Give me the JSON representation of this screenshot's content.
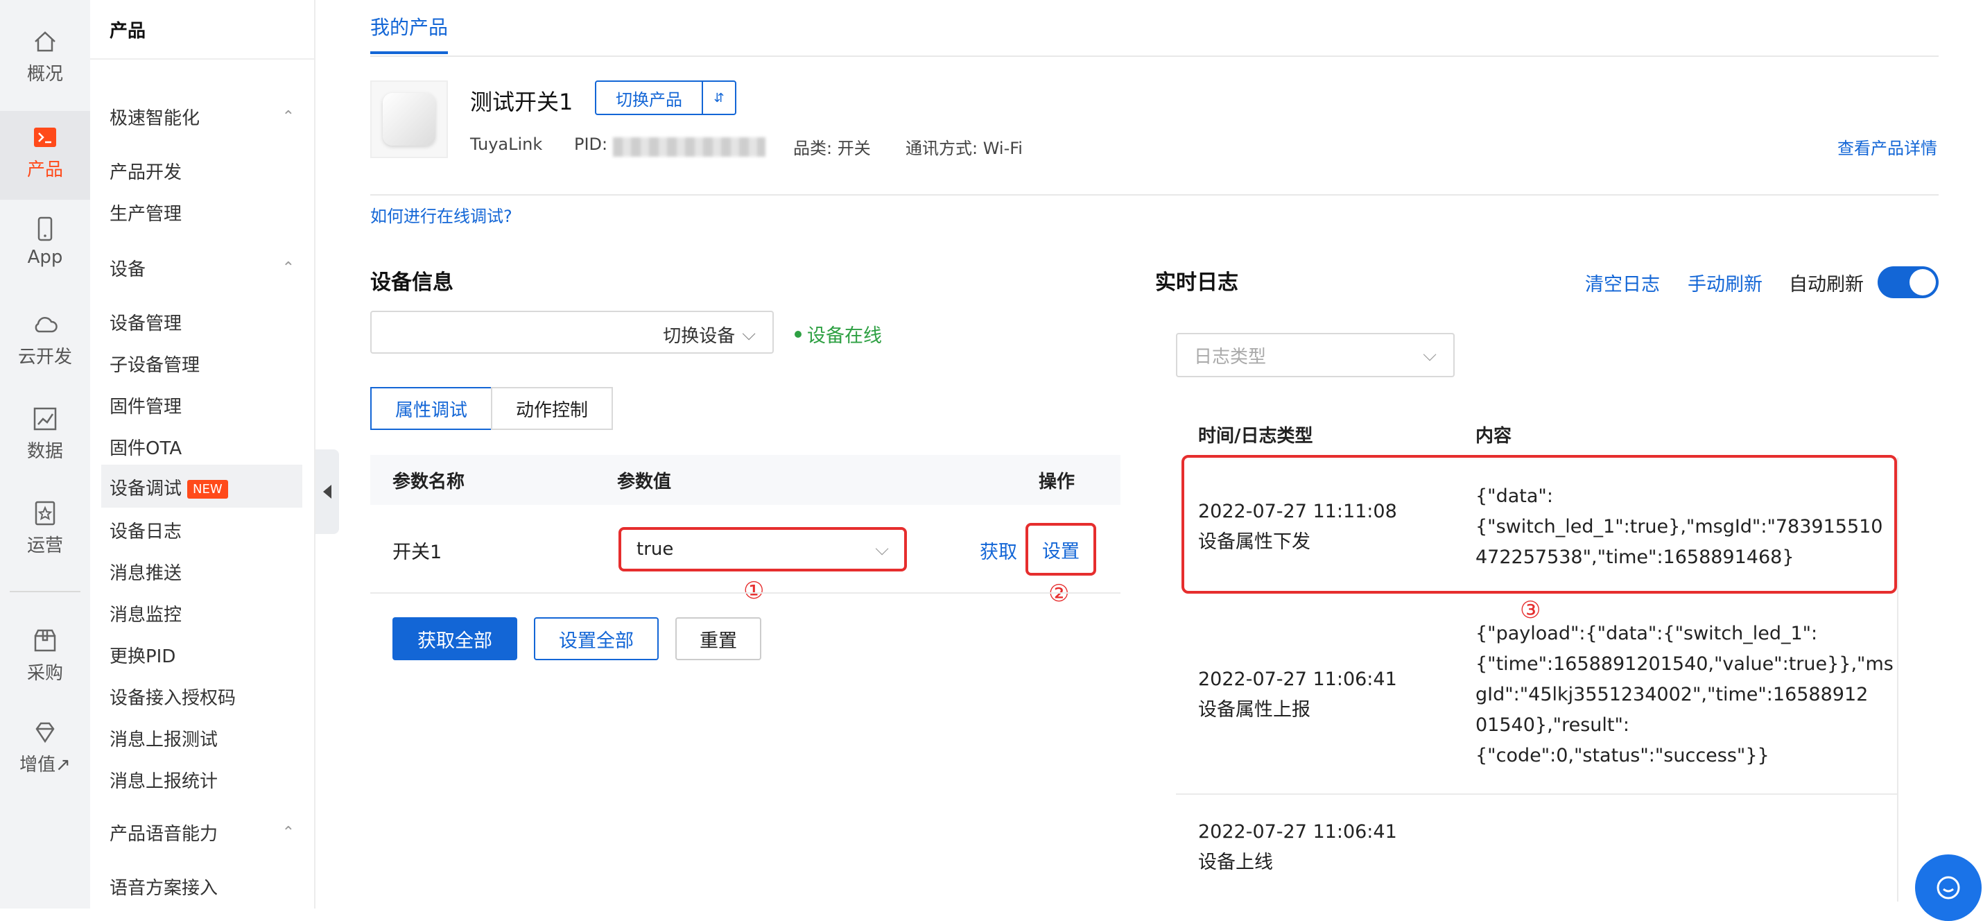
{
  "rail": {
    "items": [
      {
        "label": "概况",
        "icon": "home-icon"
      },
      {
        "label": "产品",
        "icon": "terminal-icon"
      },
      {
        "label": "App",
        "icon": "phone-icon"
      },
      {
        "label": "云开发",
        "icon": "cloud-icon"
      },
      {
        "label": "数据",
        "icon": "chart-icon"
      },
      {
        "label": "运营",
        "icon": "star-card-icon"
      },
      {
        "label": "采购",
        "icon": "box-icon"
      },
      {
        "label": "增值↗",
        "icon": "diamond-icon"
      }
    ],
    "accent": "#ff4a1a"
  },
  "menu": {
    "title": "产品",
    "sections": [
      {
        "label": "极速智能化",
        "items": [
          "产品开发",
          "生产管理"
        ]
      },
      {
        "label": "设备",
        "items": [
          "设备管理",
          "子设备管理",
          "固件管理",
          "固件OTA",
          "设备调试",
          "设备日志",
          "消息推送",
          "消息监控",
          "更换PID",
          "设备接入授权码",
          "消息上报测试",
          "消息上报统计"
        ]
      },
      {
        "label": "产品语音能力",
        "items": [
          "语音方案接入"
        ]
      }
    ],
    "active": "设备调试",
    "badge": "NEW"
  },
  "main": {
    "tab": "我的产品",
    "product": {
      "name": "测试开关1",
      "switch_label": "切换产品",
      "protocol": "TuyaLink",
      "pid_label": "PID:",
      "category": "品类: 开关",
      "comm": "通讯方式: Wi-Fi",
      "detail_link": "查看产品详情"
    },
    "help_link": "如何进行在线调试?"
  },
  "device": {
    "title": "设备信息",
    "switch_device": "切换设备",
    "status": "设备在线",
    "tabs": [
      "属性调试",
      "动作控制"
    ],
    "table": {
      "headers": [
        "参数名称",
        "参数值",
        "操作"
      ],
      "row": {
        "name": "开关1",
        "value": "true",
        "get": "获取",
        "set": "设置"
      }
    },
    "markers": [
      "①",
      "②"
    ],
    "buttons": {
      "get_all": "获取全部",
      "set_all": "设置全部",
      "reset": "重置"
    }
  },
  "log": {
    "title": "实时日志",
    "actions": [
      "清空日志",
      "手动刷新"
    ],
    "auto_refresh": "自动刷新",
    "auto_refresh_on": true,
    "type_placeholder": "日志类型",
    "headers": [
      "时间/日志类型",
      "内容"
    ],
    "marker": "③",
    "rows": [
      {
        "time": "2022-07-27 11:11:08",
        "type": "设备属性下发",
        "content": [
          "{\"data\":",
          "{\"switch_led_1\":true},\"msgId\":\"783915510",
          "472257538\",\"time\":1658891468}"
        ]
      },
      {
        "time": "2022-07-27 11:06:41",
        "type": "设备属性上报",
        "content": [
          "{\"payload\":{\"data\":{\"switch_led_1\":",
          "{\"time\":1658891201540,\"value\":true}},\"ms",
          "gId\":\"45lkj3551234002\",\"time\":16588912",
          "01540},\"result\":",
          "{\"code\":0,\"status\":\"success\"}}"
        ]
      },
      {
        "time": "2022-07-27 11:06:41",
        "type": "设备上线",
        "content": []
      }
    ]
  },
  "colors": {
    "primary": "#1366d6",
    "highlight": "#e62e2e",
    "online": "#2ea043"
  }
}
